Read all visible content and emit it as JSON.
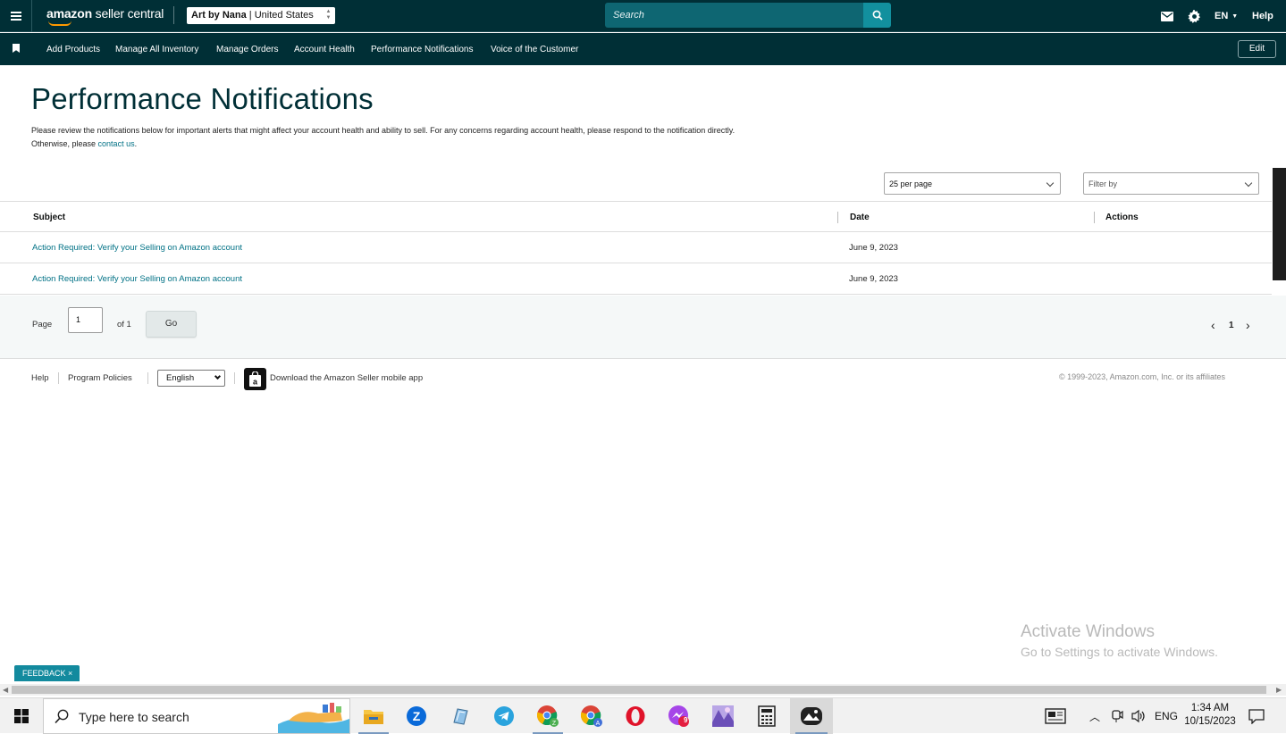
{
  "header": {
    "menu_icon": "hamburger-icon",
    "logo_prefix": "amazon",
    "logo_suffix": "seller central",
    "store_name": "Art by Nana",
    "store_marketplace": "United States",
    "search_placeholder": "Search",
    "language": "EN",
    "help_label": "Help"
  },
  "nav": {
    "items": [
      {
        "label": "Add Products"
      },
      {
        "label": "Manage All Inventory"
      },
      {
        "label": "Manage Orders"
      },
      {
        "label": "Account Health"
      },
      {
        "label": "Performance Notifications"
      },
      {
        "label": "Voice of the Customer"
      }
    ],
    "edit_label": "Edit"
  },
  "page": {
    "title": "Performance Notifications",
    "intro_line1": "Please review the notifications below for important alerts that might affect your account health and ability to sell. For any concerns regarding account health, please respond to the notification directly.",
    "intro_line2_prefix": "Otherwise, please ",
    "intro_link": "contact us",
    "intro_line2_suffix": "."
  },
  "controls": {
    "per_page": "25 per page",
    "filter_placeholder": "Filter by"
  },
  "table": {
    "headers": {
      "subject": "Subject",
      "date": "Date",
      "actions": "Actions"
    },
    "rows": [
      {
        "subject": "Action Required: Verify your Selling on Amazon account",
        "date": "June 9, 2023",
        "actions": ""
      },
      {
        "subject": "Action Required: Verify your Selling on Amazon account",
        "date": "June 9, 2023",
        "actions": ""
      }
    ]
  },
  "pagination": {
    "page_label": "Page",
    "page_value": "1",
    "of_label": "of 1",
    "go_label": "Go",
    "current_page": "1",
    "prev": "‹",
    "next": "›"
  },
  "footer": {
    "help": "Help",
    "program_policies": "Program Policies",
    "language_select": "English",
    "download_app": "Download the Amazon Seller mobile app",
    "copyright": "© 1999-2023, Amazon.com, Inc. or its affiliates"
  },
  "overlay": {
    "activate_title": "Activate Windows",
    "activate_sub": "Go to Settings to activate Windows.",
    "feedback": "FEEDBACK ×"
  },
  "taskbar": {
    "search_placeholder": "Type here to search",
    "tray_lang": "ENG",
    "time": "1:34 AM",
    "date": "10/15/2023",
    "messenger_badge": "9"
  },
  "colors": {
    "header_bg": "#002f36",
    "search_bg": "#0e6672",
    "search_btn": "#12909e",
    "link": "#007185",
    "feedback": "#138a9e"
  }
}
